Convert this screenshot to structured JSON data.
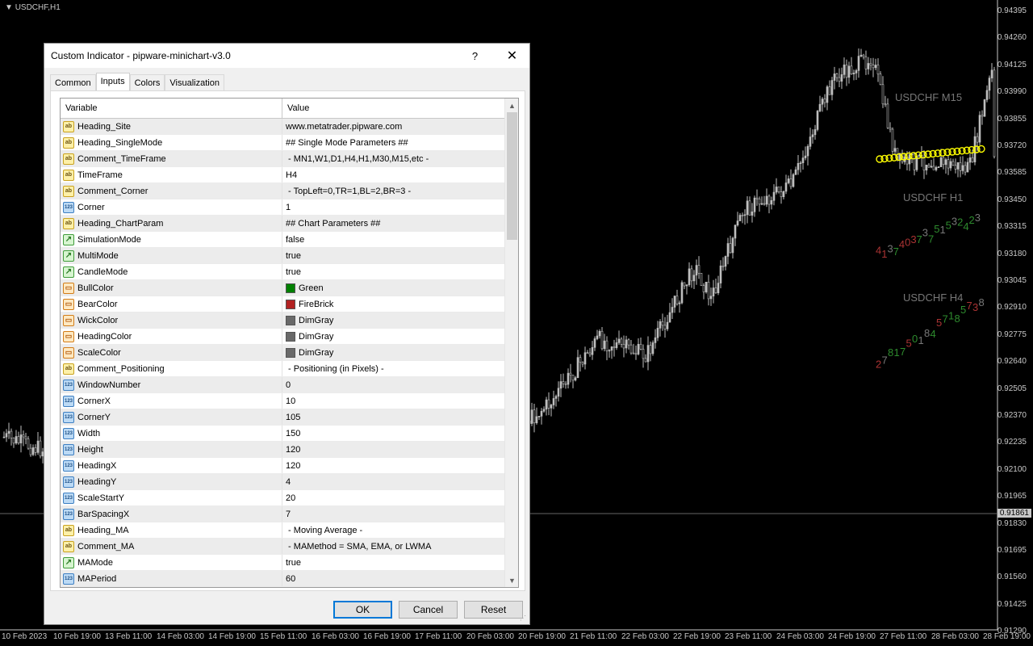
{
  "chart": {
    "title": "USDCHF,H1",
    "prices": [
      "0.94395",
      "0.94260",
      "0.94125",
      "0.93990",
      "0.93855",
      "0.93720",
      "0.93585",
      "0.93450",
      "0.93315",
      "0.93180",
      "0.93045",
      "0.92910",
      "0.92775",
      "0.92640",
      "0.92505",
      "0.92370",
      "0.92235",
      "0.92100",
      "0.91965",
      "0.91830",
      "0.91695",
      "0.91560",
      "0.91425",
      "0.91290"
    ],
    "current_price": "0.91861",
    "times": [
      "10 Feb 2023",
      "10 Feb 19:00",
      "13 Feb 11:00",
      "14 Feb 03:00",
      "14 Feb 19:00",
      "15 Feb 11:00",
      "16 Feb 03:00",
      "16 Feb 19:00",
      "17 Feb 11:00",
      "20 Feb 03:00",
      "20 Feb 19:00",
      "21 Feb 11:00",
      "22 Feb 03:00",
      "22 Feb 19:00",
      "23 Feb 11:00",
      "24 Feb 03:00",
      "24 Feb 19:00",
      "27 Feb 11:00",
      "28 Feb 03:00",
      "28 Feb 19:00"
    ],
    "mini_titles": [
      "USDCHF M15",
      "USDCHF H1",
      "USDCHF H4"
    ],
    "colors": {
      "candle": "#bfbfbf",
      "line": "#ffff00",
      "bull": "#008000",
      "bear": "#b22222"
    }
  },
  "dialog": {
    "title": "Custom Indicator - pipware-minichart-v3.0",
    "help_label": "?",
    "close_label": "✕",
    "tabs": [
      "Common",
      "Inputs",
      "Colors",
      "Visualization"
    ],
    "active_tab": "Inputs",
    "columns": {
      "variable": "Variable",
      "value": "Value"
    },
    "rows": [
      {
        "type": "ab",
        "name": "Heading_Site",
        "value": "www.metatrader.pipware.com"
      },
      {
        "type": "ab",
        "name": "Heading_SingleMode",
        "value": "## Single Mode Parameters ##"
      },
      {
        "type": "ab",
        "name": "Comment_TimeFrame",
        "value": " - MN1,W1,D1,H4,H1,M30,M15,etc -"
      },
      {
        "type": "ab",
        "name": "TimeFrame",
        "value": "H4"
      },
      {
        "type": "ab",
        "name": "Comment_Corner",
        "value": " - TopLeft=0,TR=1,BL=2,BR=3 -"
      },
      {
        "type": "123",
        "name": "Corner",
        "value": "1"
      },
      {
        "type": "ab",
        "name": "Heading_ChartParam",
        "value": "## Chart Parameters ##"
      },
      {
        "type": "bool",
        "name": "SimulationMode",
        "value": "false"
      },
      {
        "type": "bool",
        "name": "MultiMode",
        "value": "true"
      },
      {
        "type": "bool",
        "name": "CandleMode",
        "value": "true"
      },
      {
        "type": "color",
        "name": "BullColor",
        "value": "Green",
        "swatch": "#008000"
      },
      {
        "type": "color",
        "name": "BearColor",
        "value": "FireBrick",
        "swatch": "#b22222"
      },
      {
        "type": "color",
        "name": "WickColor",
        "value": "DimGray",
        "swatch": "#696969"
      },
      {
        "type": "color",
        "name": "HeadingColor",
        "value": "DimGray",
        "swatch": "#696969"
      },
      {
        "type": "color",
        "name": "ScaleColor",
        "value": "DimGray",
        "swatch": "#696969"
      },
      {
        "type": "ab",
        "name": "Comment_Positioning",
        "value": " - Positioning (in Pixels) -"
      },
      {
        "type": "123",
        "name": "WindowNumber",
        "value": "0"
      },
      {
        "type": "123",
        "name": "CornerX",
        "value": "10"
      },
      {
        "type": "123",
        "name": "CornerY",
        "value": "105"
      },
      {
        "type": "123",
        "name": "Width",
        "value": "150"
      },
      {
        "type": "123",
        "name": "Height",
        "value": "120"
      },
      {
        "type": "123",
        "name": "HeadingX",
        "value": "120"
      },
      {
        "type": "123",
        "name": "HeadingY",
        "value": "4"
      },
      {
        "type": "123",
        "name": "ScaleStartY",
        "value": "20"
      },
      {
        "type": "123",
        "name": "BarSpacingX",
        "value": "7"
      },
      {
        "type": "ab",
        "name": "Heading_MA",
        "value": " - Moving Average -"
      },
      {
        "type": "ab",
        "name": "Comment_MA",
        "value": " - MAMethod = SMA, EMA, or LWMA"
      },
      {
        "type": "bool",
        "name": "MAMode",
        "value": "true"
      },
      {
        "type": "123",
        "name": "MAPeriod",
        "value": "60"
      }
    ],
    "buttons": {
      "ok": "OK",
      "cancel": "Cancel",
      "reset": "Reset"
    }
  }
}
